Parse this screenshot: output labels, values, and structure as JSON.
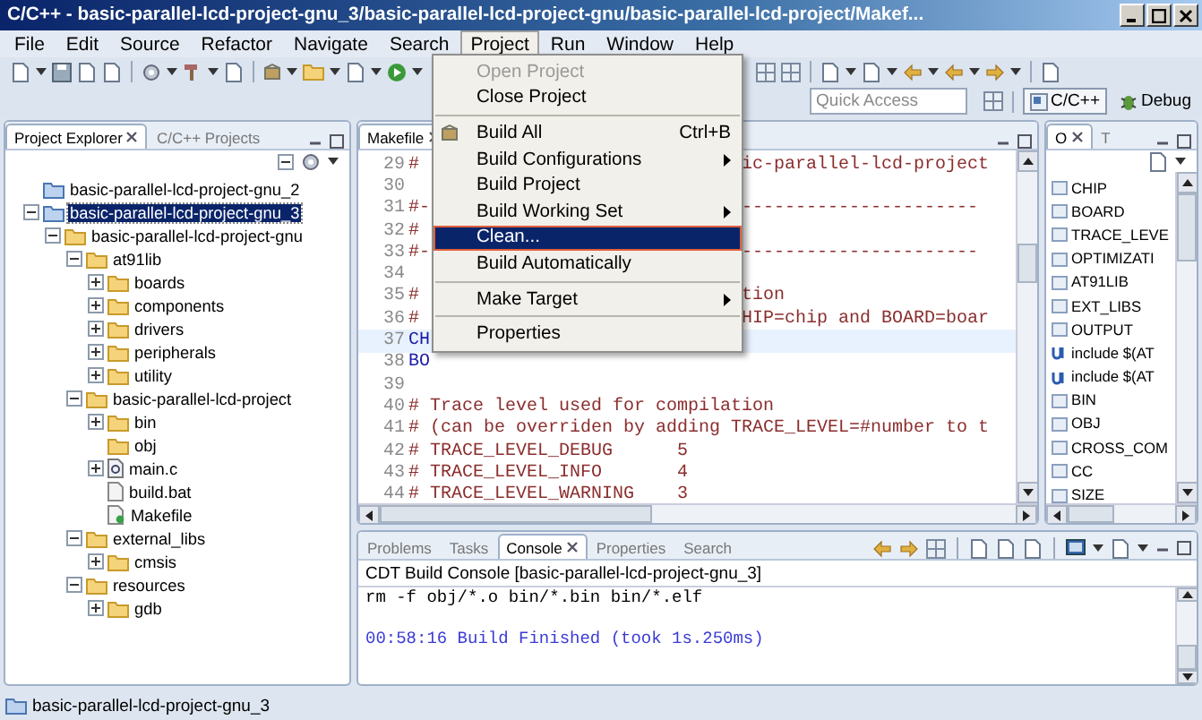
{
  "window": {
    "title": "C/C++ - basic-parallel-lcd-project-gnu_3/basic-parallel-lcd-project-gnu/basic-parallel-lcd-project/Makef..."
  },
  "menu_bar": [
    {
      "label": "File",
      "selected": false
    },
    {
      "label": "Edit",
      "selected": false
    },
    {
      "label": "Source",
      "selected": false
    },
    {
      "label": "Refactor",
      "selected": false
    },
    {
      "label": "Navigate",
      "selected": false
    },
    {
      "label": "Search",
      "selected": false
    },
    {
      "label": "Project",
      "selected": true
    },
    {
      "label": "Run",
      "selected": false
    },
    {
      "label": "Window",
      "selected": false
    },
    {
      "label": "Help",
      "selected": false
    }
  ],
  "toolbar": {
    "quick_access": {
      "placeholder": "Quick Access"
    },
    "perspectives": [
      {
        "label": "C/C++",
        "selected": true
      },
      {
        "label": "Debug",
        "selected": false
      }
    ]
  },
  "project_explorer": {
    "tabs": [
      {
        "label": "Project Explorer",
        "selected": true
      },
      {
        "label": "C/C++ Projects",
        "selected": false
      }
    ],
    "tree": [
      {
        "label": "basic-parallel-lcd-project-gnu_2",
        "kind": "project",
        "selected": false
      },
      {
        "label": "basic-parallel-lcd-project-gnu_3",
        "kind": "project",
        "selected": true,
        "expanded": true,
        "children": [
          {
            "label": "basic-parallel-lcd-project-gnu",
            "kind": "folder",
            "selected": false,
            "expanded": true,
            "children": [
              {
                "label": "at91lib",
                "kind": "folder",
                "selected": false,
                "expanded": true,
                "children": [
                  {
                    "label": "boards",
                    "kind": "folder",
                    "selected": false,
                    "expanded": false
                  },
                  {
                    "label": "components",
                    "kind": "folder",
                    "selected": false,
                    "expanded": false
                  },
                  {
                    "label": "drivers",
                    "kind": "folder",
                    "selected": false,
                    "expanded": false
                  },
                  {
                    "label": "peripherals",
                    "kind": "folder",
                    "selected": false,
                    "expanded": false
                  },
                  {
                    "label": "utility",
                    "kind": "folder",
                    "selected": false,
                    "expanded": false
                  }
                ]
              },
              {
                "label": "basic-parallel-lcd-project",
                "kind": "folder",
                "selected": false,
                "expanded": true,
                "children": [
                  {
                    "label": "bin",
                    "kind": "folder",
                    "selected": false,
                    "expanded": false
                  },
                  {
                    "label": "obj",
                    "kind": "folder",
                    "selected": false
                  },
                  {
                    "label": "main.c",
                    "kind": "c-file",
                    "selected": false,
                    "expanded": false
                  },
                  {
                    "label": "build.bat",
                    "kind": "file",
                    "selected": false
                  },
                  {
                    "label": "Makefile",
                    "kind": "makefile",
                    "selected": false
                  }
                ]
              },
              {
                "label": "external_libs",
                "kind": "folder",
                "selected": false,
                "expanded": true,
                "children": [
                  {
                    "label": "cmsis",
                    "kind": "folder",
                    "selected": false,
                    "expanded": false
                  }
                ]
              },
              {
                "label": "resources",
                "kind": "folder",
                "selected": false,
                "expanded": true,
                "children": [
                  {
                    "label": "gdb",
                    "kind": "folder",
                    "selected": false,
                    "expanded": false
                  }
                ]
              }
            ]
          }
        ]
      }
    ]
  },
  "editor": {
    "tabs": [
      {
        "label": "Makefile",
        "selected": true
      }
    ],
    "lines": [
      {
        "number": "29",
        "text": "#",
        "tail": "ic-parallel-lcd-project",
        "kind": "comment",
        "current": false
      },
      {
        "number": "30",
        "current": false
      },
      {
        "number": "31",
        "text": "#-",
        "tail": "----------------------",
        "kind": "comment",
        "current": false
      },
      {
        "number": "32",
        "text": "#",
        "kind": "comment",
        "current": false
      },
      {
        "number": "33",
        "text": "#-",
        "tail": "----------------------",
        "kind": "comment",
        "current": false
      },
      {
        "number": "34",
        "current": false
      },
      {
        "number": "35",
        "text": "#",
        "tail": "tion",
        "kind": "comment",
        "current": false
      },
      {
        "number": "36",
        "text": "#",
        "tail": "HIP=chip and BOARD=boar",
        "kind": "comment",
        "current": false
      },
      {
        "number": "37",
        "text": "CH",
        "kind": "variable",
        "current": true
      },
      {
        "number": "38",
        "text": "BO",
        "kind": "variable",
        "current": false
      },
      {
        "number": "39",
        "current": false
      },
      {
        "number": "40",
        "text": "# Trace level used for compilation",
        "kind": "comment",
        "current": false
      },
      {
        "number": "41",
        "text": "# (can be overriden by adding TRACE_LEVEL=#number to t",
        "kind": "comment",
        "current": false
      },
      {
        "number": "42",
        "text": "# TRACE_LEVEL_DEBUG      5",
        "kind": "comment",
        "current": false
      },
      {
        "number": "43",
        "text": "# TRACE_LEVEL_INFO       4",
        "kind": "comment",
        "current": false
      },
      {
        "number": "44",
        "text": "# TRACE_LEVEL_WARNING    3",
        "kind": "comment",
        "current": false
      }
    ]
  },
  "outline": {
    "tabs": [
      {
        "label": "O",
        "selected": true
      },
      {
        "label": "T",
        "selected": false
      }
    ],
    "items": [
      {
        "label": "CHIP",
        "kind": "variable"
      },
      {
        "label": "BOARD",
        "kind": "variable"
      },
      {
        "label": "TRACE_LEVE",
        "kind": "variable"
      },
      {
        "label": "OPTIMIZATI",
        "kind": "variable"
      },
      {
        "label": "AT91LIB",
        "kind": "variable"
      },
      {
        "label": "EXT_LIBS",
        "kind": "variable"
      },
      {
        "label": "OUTPUT",
        "kind": "variable"
      },
      {
        "label": "include $(AT",
        "kind": "include"
      },
      {
        "label": "include $(AT",
        "kind": "include"
      },
      {
        "label": "BIN",
        "kind": "variable"
      },
      {
        "label": "OBJ",
        "kind": "variable"
      },
      {
        "label": "CROSS_COM",
        "kind": "variable"
      },
      {
        "label": "CC",
        "kind": "variable"
      },
      {
        "label": "SIZE",
        "kind": "variable"
      }
    ]
  },
  "console": {
    "tabs": [
      {
        "label": "Problems",
        "selected": false
      },
      {
        "label": "Tasks",
        "selected": false
      },
      {
        "label": "Console",
        "selected": true
      },
      {
        "label": "Properties",
        "selected": false
      },
      {
        "label": "Search",
        "selected": false
      }
    ],
    "title": "CDT Build Console [basic-parallel-lcd-project-gnu_3]",
    "lines": [
      {
        "text": "rm -f obj/*.o bin/*.bin bin/*.elf",
        "kind": "output"
      },
      {
        "text": "00:58:16 Build Finished (took 1s.250ms)",
        "kind": "status"
      }
    ]
  },
  "project_menu": {
    "items": [
      {
        "kind": "item",
        "label": "Open Project",
        "disabled": true,
        "selected": false
      },
      {
        "kind": "item",
        "label": "Close Project",
        "disabled": false,
        "selected": false
      },
      {
        "kind": "separator"
      },
      {
        "kind": "item",
        "label": "Build All",
        "shortcut": "Ctrl+B",
        "disabled": false,
        "selected": false
      },
      {
        "kind": "submenu",
        "label": "Build Configurations",
        "disabled": false,
        "selected": false
      },
      {
        "kind": "item",
        "label": "Build Project",
        "disabled": false,
        "selected": false
      },
      {
        "kind": "submenu",
        "label": "Build Working Set",
        "disabled": false,
        "selected": false
      },
      {
        "kind": "item",
        "label": "Clean...",
        "disabled": false,
        "selected": true
      },
      {
        "kind": "item",
        "label": "Build Automatically",
        "disabled": false,
        "selected": false
      },
      {
        "kind": "separator"
      },
      {
        "kind": "submenu",
        "label": "Make Target",
        "disabled": false,
        "selected": false
      },
      {
        "kind": "separator"
      },
      {
        "kind": "item",
        "label": "Properties",
        "disabled": false,
        "selected": false
      }
    ]
  },
  "status_bar": {
    "text": "basic-parallel-lcd-project-gnu_3"
  }
}
